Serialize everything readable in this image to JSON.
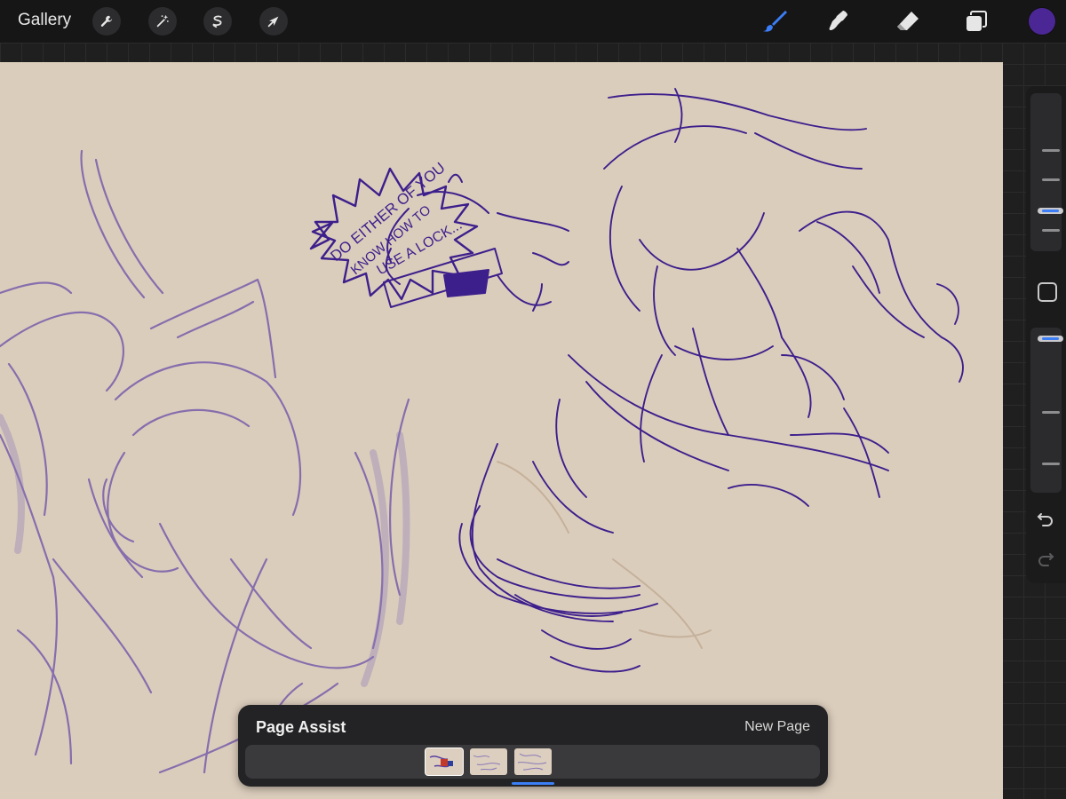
{
  "toolbar": {
    "gallery_label": "Gallery",
    "left_tools": [
      "wrench-icon",
      "magic-wand-icon",
      "selection-icon",
      "transform-arrow-icon"
    ],
    "right_tools": [
      "brush-icon",
      "smudge-icon",
      "eraser-icon",
      "layers-icon"
    ],
    "active_tool": "brush-icon",
    "active_color": "#4b2796",
    "accent_color": "#3b7ef6"
  },
  "canvas": {
    "paper_color": "#dbcdbc",
    "ink_color": "#3d1f8c",
    "speech_bubble_text": [
      "DO EITHER OF YOU",
      "KNOW HOW TO",
      "USE A LOCK..."
    ]
  },
  "page_assist": {
    "title": "Page Assist",
    "new_page_label": "New Page",
    "page_count": 3,
    "active_page": 1
  }
}
